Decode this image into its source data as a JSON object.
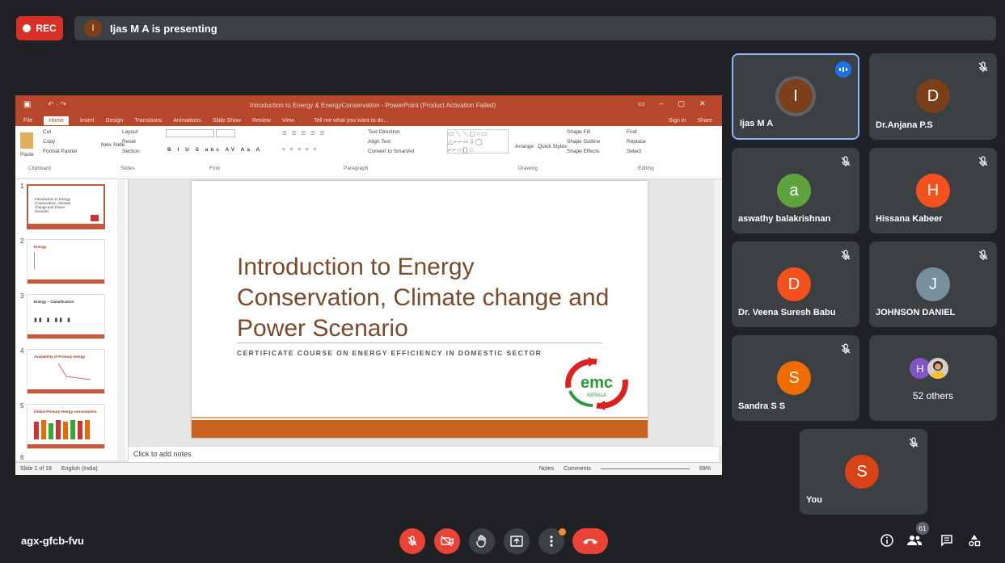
{
  "top": {
    "rec_label": "REC",
    "presenter_initial": "I",
    "presenting_text": "Ijas M A is presenting"
  },
  "powerpoint": {
    "window_title": "Introduction to Energy & EnergyConservation - PowerPoint (Product Activation Failed)",
    "tabs": [
      "File",
      "Home",
      "Insert",
      "Design",
      "Transitions",
      "Animations",
      "Slide Show",
      "Review",
      "View"
    ],
    "tell_me": "Tell me what you want to do...",
    "sign_in": "Sign in",
    "share": "Share",
    "ribbon": {
      "cut": "Cut",
      "copy": "Copy",
      "paste": "Paste",
      "format_painter": "Format Painter",
      "new_slide": "New Slide",
      "layout": "Layout",
      "reset": "Reset",
      "section": "Section",
      "text_direction": "Text Direction",
      "align_text": "Align Text",
      "convert_smartart": "Convert to SmartArt",
      "arrange": "Arrange",
      "quick_styles": "Quick Styles",
      "shape_fill": "Shape Fill",
      "shape_outline": "Shape Outline",
      "shape_effects": "Shape Effects",
      "find": "Find",
      "replace": "Replace",
      "select": "Select",
      "groups": [
        "Clipboard",
        "Slides",
        "Font",
        "Paragraph",
        "Drawing",
        "Editing"
      ]
    },
    "thumbnails": [
      {
        "num": "1",
        "text": "Introduction to Energy Conservation, Climate change and Power Scenario"
      },
      {
        "num": "2",
        "text": "Energy"
      },
      {
        "num": "3",
        "text": "Energy – Classification"
      },
      {
        "num": "4",
        "text": "Availability of Primary energy"
      },
      {
        "num": "5",
        "text": "Global Primary energy consumption"
      },
      {
        "num": "6",
        "text": ""
      }
    ],
    "slide": {
      "title": "Introduction to Energy Conservation, Climate change and Power Scenario",
      "subtitle": "CERTIFICATE COURSE ON ENERGY EFFICIENCY IN DOMESTIC SECTOR",
      "logo_text": "emc",
      "logo_subtext": "KERALA"
    },
    "notes_placeholder": "Click to add notes",
    "status": {
      "slide_of": "Slide 1 of 18",
      "language": "English (India)",
      "notes": "Notes",
      "comments": "Comments",
      "zoom": "69%"
    }
  },
  "participants": [
    {
      "name": "Ijas M A",
      "initial": "I",
      "color": "#7b3f1a",
      "speaking": true
    },
    {
      "name": "Dr.Anjana P.S",
      "initial": "D",
      "color": "#7b3f1a",
      "muted": true
    },
    {
      "name": "aswathy balakrishnan",
      "initial": "a",
      "color": "#5ea33e",
      "muted": true
    },
    {
      "name": "Hissana Kabeer",
      "initial": "H",
      "color": "#f4511e",
      "muted": true
    },
    {
      "name": "Dr. Veena Suresh Babu",
      "initial": "D",
      "color": "#f4511e",
      "muted": true
    },
    {
      "name": "JOHNSON DANIEL",
      "initial": "J",
      "color": "#78909c",
      "muted": true
    },
    {
      "name": "Sandra S S",
      "initial": "S",
      "color": "#ef6c00",
      "muted": true
    },
    {
      "name": "52 others",
      "initial": "H",
      "color": "#7e57c2"
    },
    {
      "name": "You",
      "initial": "S",
      "color": "#d84315",
      "muted": true
    }
  ],
  "bottom": {
    "meeting_code": "agx-gfcb-fvu",
    "people_count": "61"
  }
}
